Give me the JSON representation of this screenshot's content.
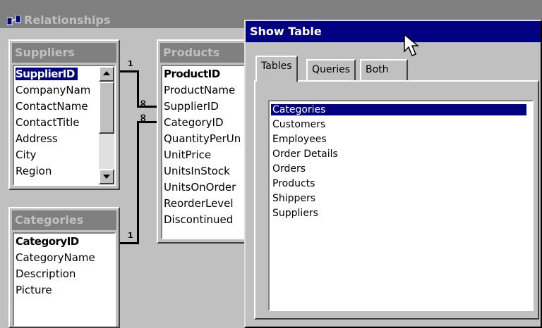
{
  "relationships": {
    "title": "Relationships",
    "tables": {
      "suppliers": {
        "caption": "Suppliers",
        "fields": [
          "SupplierID",
          "CompanyNam",
          "ContactName",
          "ContactTitle",
          "Address",
          "City",
          "Region"
        ]
      },
      "products": {
        "caption": "Products",
        "fields": [
          "ProductID",
          "ProductName",
          "SupplierID",
          "CategoryID",
          "QuantityPerUn",
          "UnitPrice",
          "UnitsInStock",
          "UnitsOnOrder",
          "ReorderLevel",
          "Discontinued"
        ]
      },
      "categories": {
        "caption": "Categories",
        "fields": [
          "CategoryID",
          "CategoryName",
          "Description",
          "Picture"
        ]
      }
    },
    "relations": {
      "one_label": "1",
      "many_label": "∞"
    }
  },
  "show_table": {
    "title": "Show Table",
    "tabs": [
      "Tables",
      "Queries",
      "Both"
    ],
    "active_tab": "Tables",
    "tables": [
      "Categories",
      "Customers",
      "Employees",
      "Order Details",
      "Orders",
      "Products",
      "Shippers",
      "Suppliers"
    ],
    "selected": "Categories"
  },
  "icons": {
    "window_icon": "relationships-icon",
    "cursor": "mouse-pointer-icon"
  },
  "colors": {
    "title_active": "#000080",
    "title_inactive": "#808080",
    "face": "#c0c0c0"
  }
}
